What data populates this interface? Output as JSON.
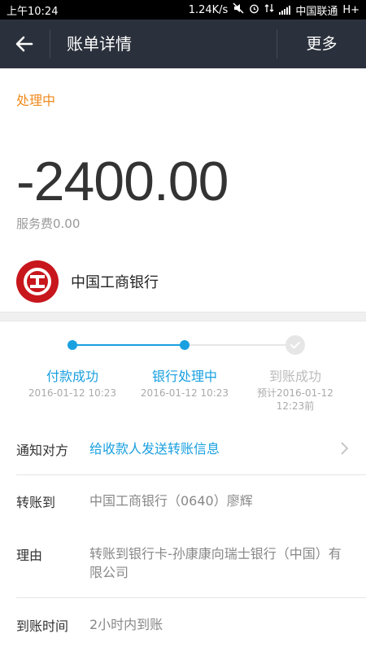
{
  "statusbar": {
    "time": "上午10:24",
    "speed": "1.24K/s",
    "carrier": "中国联通",
    "network": "H+"
  },
  "nav": {
    "back_icon": "arrow-left-icon",
    "title": "账单详情",
    "more_label": "更多"
  },
  "bill": {
    "status": "处理中",
    "amount": "-2400.00",
    "fee": "服务费0.00",
    "bank_name": "中国工商银行",
    "bank_logo_icon": "icbc-logo"
  },
  "progress": {
    "steps": [
      {
        "label": "付款成功",
        "time": "2016-01-12 10:23",
        "state": "done"
      },
      {
        "label": "银行处理中",
        "time": "2016-01-12 10:23",
        "state": "current"
      },
      {
        "label": "到账成功",
        "time": "预计2016-01-12 12:23前",
        "state": "pending"
      }
    ]
  },
  "details": {
    "notify_label": "通知对方",
    "notify_action": "给收款人发送转账信息",
    "transfer_to_label": "转账到",
    "transfer_to_value": "中国工商银行（0640）廖辉",
    "reason_label": "理由",
    "reason_value": "转账到银行卡-孙康康向瑞士银行（中国）有限公司",
    "arrival_label": "到账时间",
    "arrival_value": "2小时内到账"
  },
  "colors": {
    "nav_bg": "#2b313c",
    "accent_blue": "#1aa0e0",
    "status_orange": "#f08a1c",
    "icbc_red": "#c8161d"
  }
}
